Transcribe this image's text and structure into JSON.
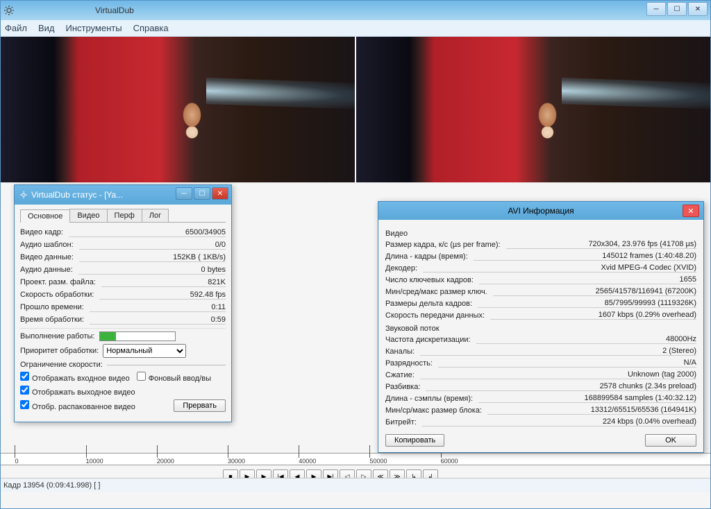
{
  "app": {
    "title": "VirtualDub"
  },
  "menu": {
    "file": "Файл",
    "view": "Вид",
    "tools": "Инструменты",
    "help": "Справка"
  },
  "status_dialog": {
    "title": "VirtualDub статус - [Ya...",
    "tabs": {
      "main": "Основное",
      "video": "Видео",
      "perf": "Перф",
      "log": "Лог"
    },
    "rows": {
      "video_frame_lbl": "Видео кадр:",
      "video_frame_val": "6500/34905",
      "audio_tpl_lbl": "Аудио шаблон:",
      "audio_tpl_val": "0/0",
      "video_data_lbl": "Видео данные:",
      "video_data_val": "152KB (  1KB/s)",
      "audio_data_lbl": "Аудио данные:",
      "audio_data_val": "0 bytes",
      "proj_size_lbl": "Проект. разм. файла:",
      "proj_size_val": "821K",
      "proc_speed_lbl": "Скорость обработки:",
      "proc_speed_val": "592.48 fps",
      "elapsed_lbl": "Прошло времени:",
      "elapsed_val": "0:11",
      "proc_time_lbl": "Время обработки:",
      "proc_time_val": "0:59"
    },
    "progress_lbl": "Выполнение работы:",
    "priority_lbl": "Приоритет обработки:",
    "priority_val": "Нормальный",
    "limit_lbl": "Ограничение скорости:",
    "cb1": "Отображать входное видео",
    "cb_bg": "Фоновый ввод/вы",
    "cb2": "Отображать выходное видео",
    "cb3": "Отобр. распакованное видео",
    "abort": "Прервать"
  },
  "avi_dialog": {
    "title": "AVI Информация",
    "video_lbl": "Видео",
    "rows_v": {
      "frame_size_lbl": "Размер кадра, к/с (µs per frame):",
      "frame_size_val": "720x304, 23.976 fps (41708 µs)",
      "length_lbl": "Длина - кадры (время):",
      "length_val": "145012 frames (1:40:48.20)",
      "decoder_lbl": "Декодер:",
      "decoder_val": "Xvid MPEG-4 Codec (XVID)",
      "keyframes_lbl": "Число ключевых кадров:",
      "keyframes_val": "1655",
      "keysize_lbl": "Мин/сред/макс размер ключ.",
      "keysize_val": "2565/41578/116941 (67200K)",
      "deltasize_lbl": "Размеры дельта кадров:",
      "deltasize_val": "85/7995/99993 (1119326K)",
      "datarate_lbl": "Скорость передачи данных:",
      "datarate_val": "1607 kbps (0.29% overhead)"
    },
    "audio_lbl": "Звуковой поток",
    "rows_a": {
      "srate_lbl": "Частота дискретизации:",
      "srate_val": "48000Hz",
      "channels_lbl": "Каналы:",
      "channels_val": "2 (Stereo)",
      "bits_lbl": "Разрядность:",
      "bits_val": "N/A",
      "compress_lbl": "Сжатие:",
      "compress_val": "Unknown (tag 2000)",
      "chunks_lbl": "Разбивка:",
      "chunks_val": "2578 chunks (2.34s preload)",
      "alength_lbl": "Длина - сэмплы (время):",
      "alength_val": "168899584 samples (1:40:32.12)",
      "block_lbl": "Мин/ср/макс размер блока:",
      "block_val": "13312/65515/65536 (164941K)",
      "bitrate_lbl": "Битрейт:",
      "bitrate_val": "224 kbps (0.04% overhead)"
    },
    "copy": "Копировать",
    "ok": "OK"
  },
  "timeline": {
    "ticks": [
      "0",
      "10000",
      "20000",
      "30000",
      "40000",
      "50000",
      "60000"
    ]
  },
  "statusbar": {
    "text": "Кадр 13954 (0:09:41.998) [ ]"
  }
}
